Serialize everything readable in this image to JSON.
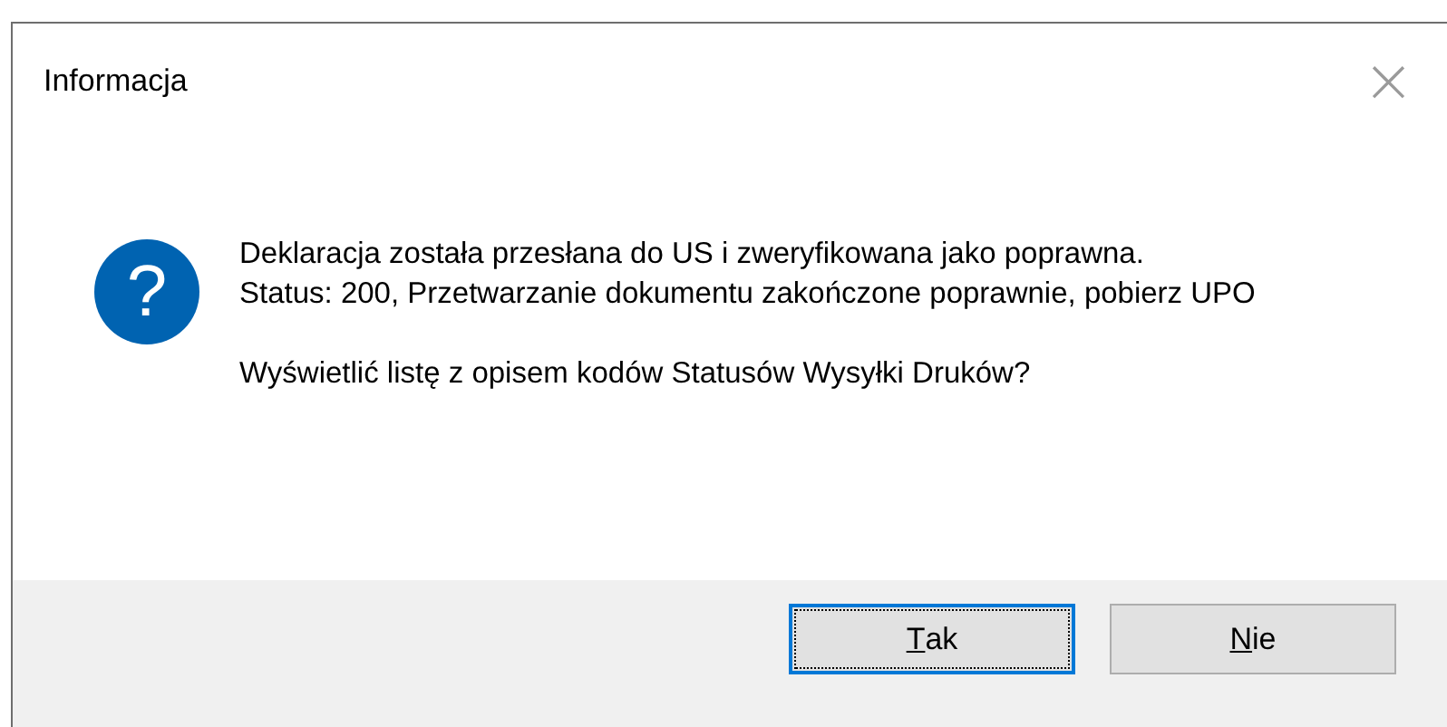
{
  "window": {
    "title": "Informacja",
    "close": "×"
  },
  "message": {
    "paragraphs": [
      "Deklaracja została przesłana do US i zweryfikowana jako poprawna.",
      "Status: 200, Przetwarzanie dokumentu zakończone poprawnie, pobierz UPO"
    ],
    "question": "Wyświetlić listę z opisem kodów Statusów Wysyłki Druków?",
    "icon": "?"
  },
  "buttons": [
    {
      "label": "Tak",
      "default": true,
      "underline_first": true
    },
    {
      "label": "Nie",
      "default": false,
      "underline_first": true
    }
  ]
}
